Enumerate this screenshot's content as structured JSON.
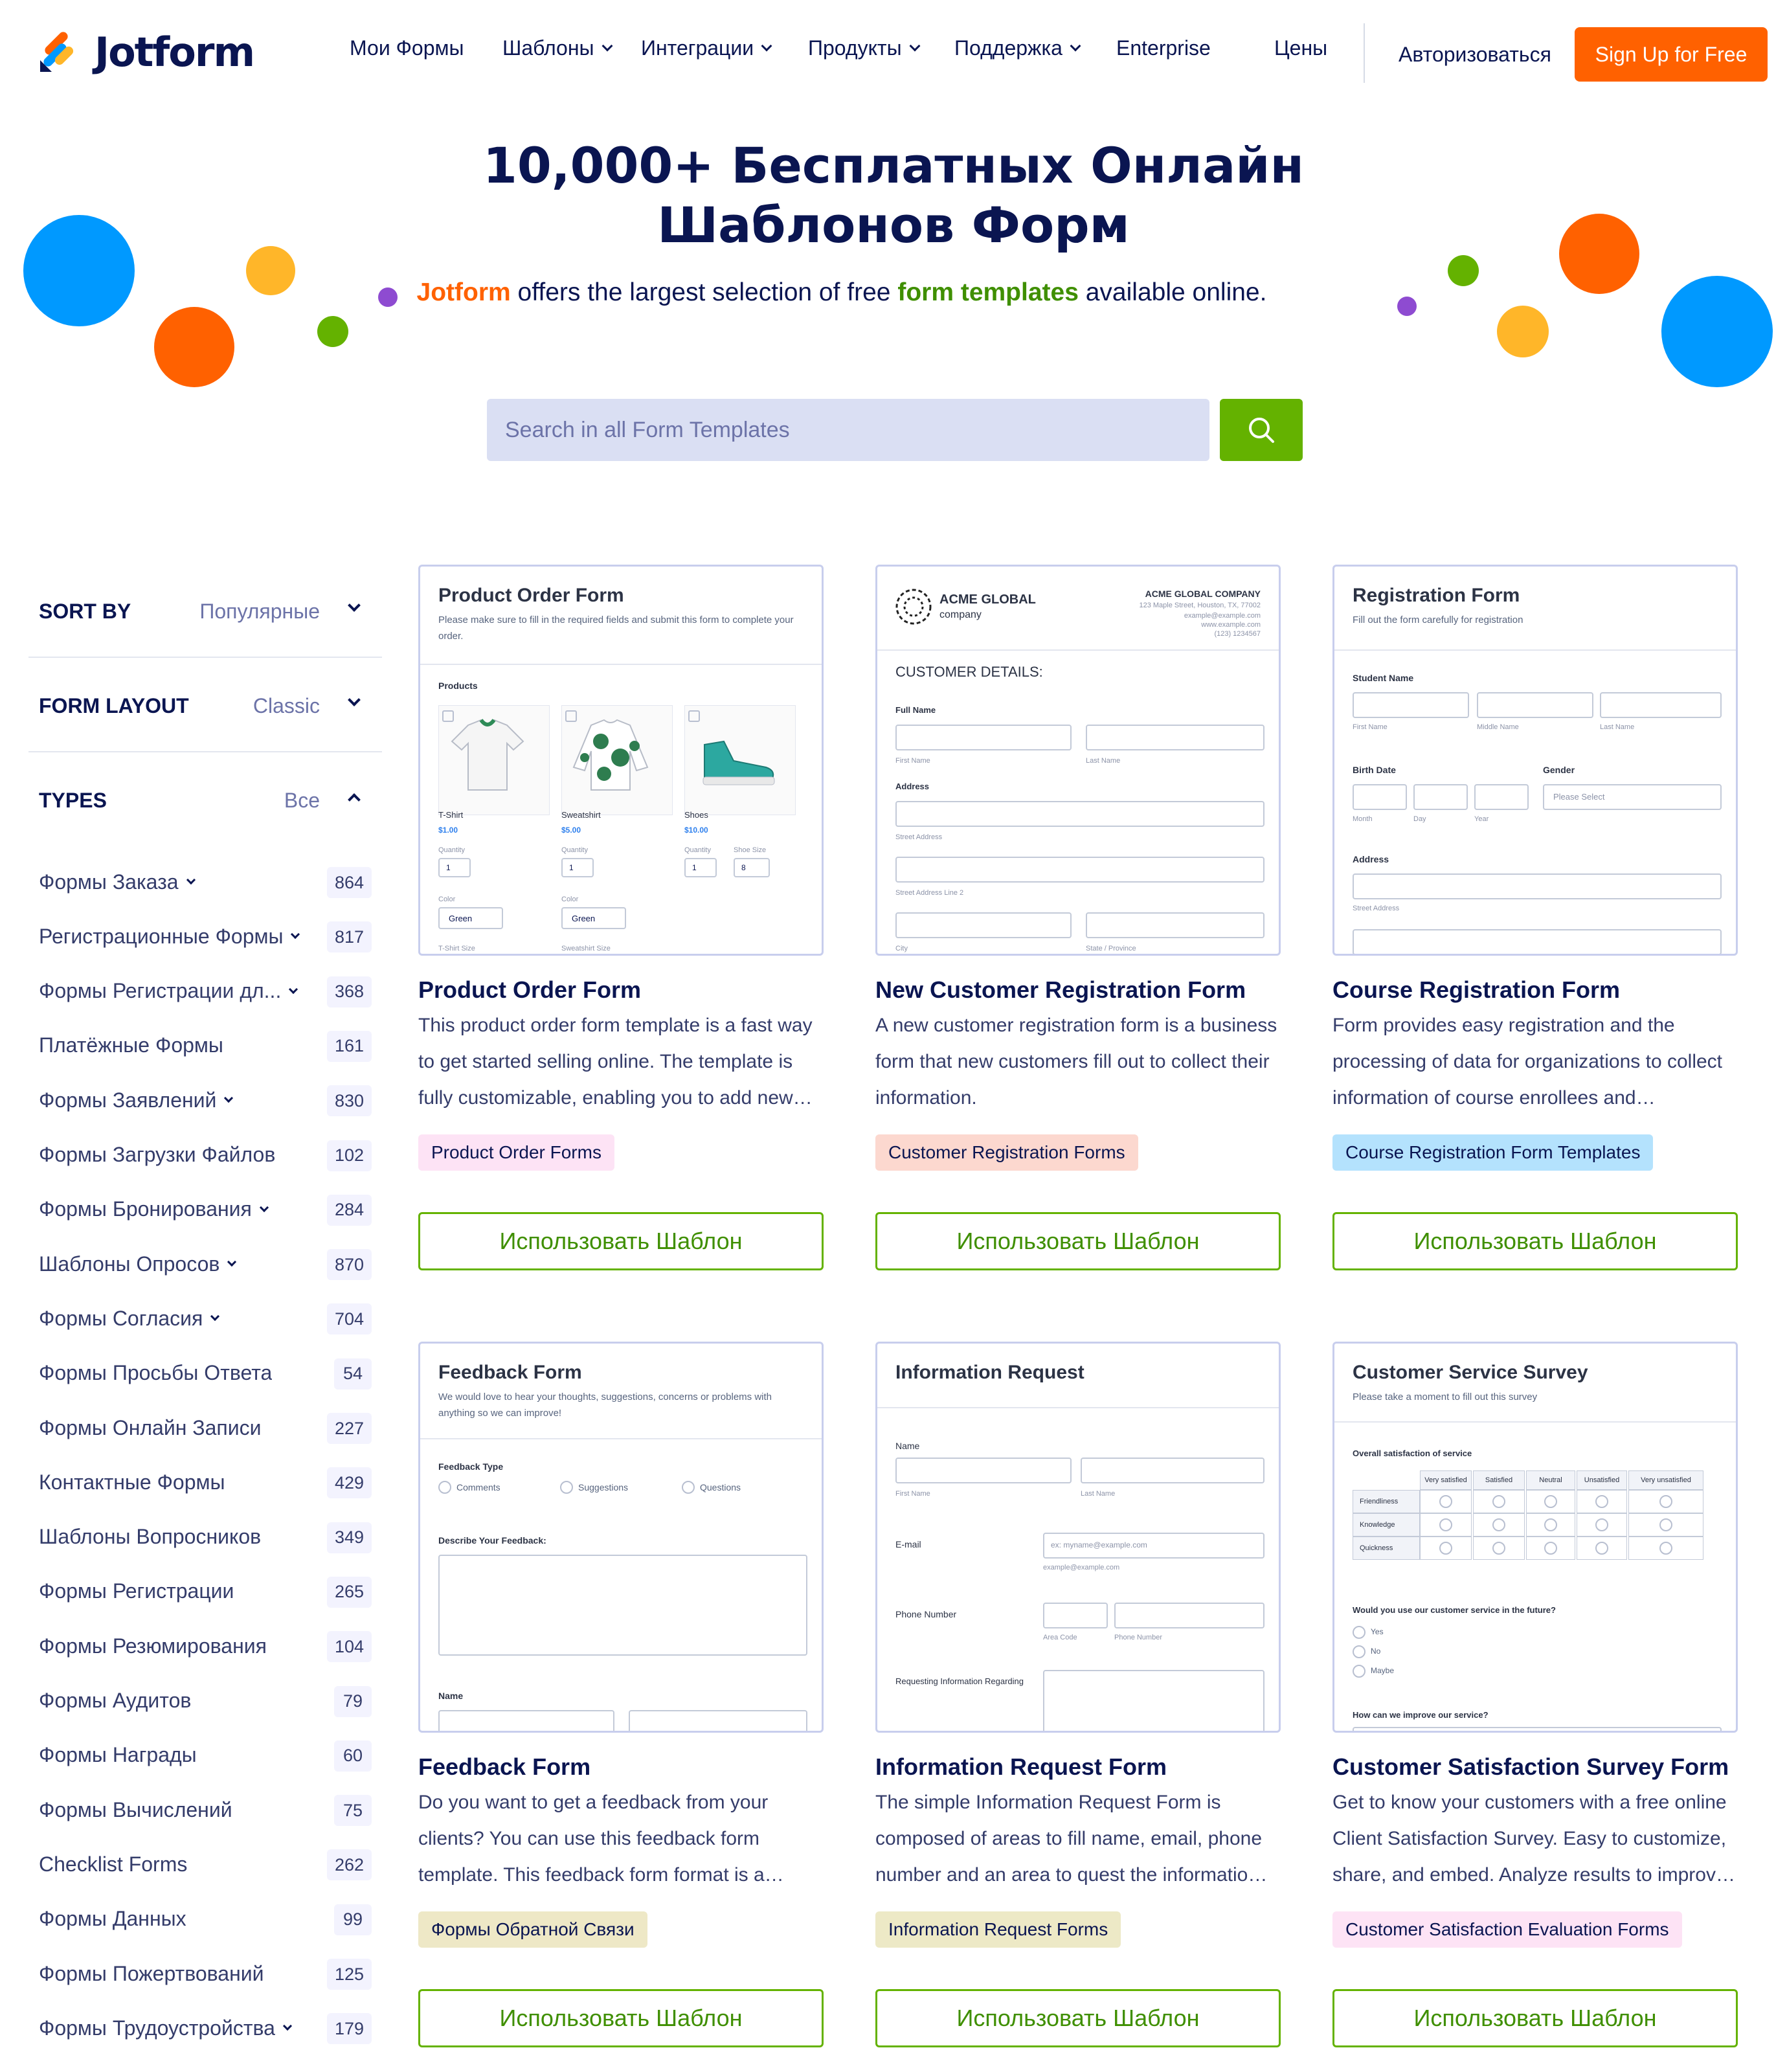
{
  "header": {
    "logo_text": "Jotform",
    "nav": [
      {
        "label": "Мои Формы",
        "dropdown": false
      },
      {
        "label": "Шаблоны",
        "dropdown": true
      },
      {
        "label": "Интеграции",
        "dropdown": true
      },
      {
        "label": "Продукты",
        "dropdown": true
      },
      {
        "label": "Поддержка",
        "dropdown": true
      },
      {
        "label": "Enterprise",
        "dropdown": false
      },
      {
        "label": "Цены",
        "dropdown": false
      }
    ],
    "login_label": "Авторизоваться",
    "signup_label": "Sign Up for Free"
  },
  "hero": {
    "title_line1": "10,000+ Бесплатных Онлайн",
    "title_line2": "Шаблонов Форм",
    "sub_brand": "Jotform",
    "sub_part1": " offers the largest selection of free ",
    "sub_link": "form templates",
    "sub_part2": " available online.",
    "search_placeholder": "Search in all Form Templates"
  },
  "colors": {
    "brand_orange": "#ff6100",
    "brand_green": "#64b200",
    "navy": "#0a1551"
  },
  "sidebar": {
    "sort": {
      "label": "SORT BY",
      "value": "Популярные"
    },
    "layout": {
      "label": "FORM LAYOUT",
      "value": "Classic"
    },
    "types": {
      "label": "TYPES",
      "value": "Все"
    },
    "items": [
      {
        "label": "Формы Заказа",
        "count": "864",
        "expandable": true
      },
      {
        "label": "Регистрационные Формы",
        "count": "817",
        "expandable": true
      },
      {
        "label": "Формы Регистрации дл...",
        "count": "368",
        "expandable": true
      },
      {
        "label": "Платёжные Формы",
        "count": "161",
        "expandable": false
      },
      {
        "label": "Формы Заявлений",
        "count": "830",
        "expandable": true
      },
      {
        "label": "Формы Загрузки Файлов",
        "count": "102",
        "expandable": false
      },
      {
        "label": "Формы Бронирования",
        "count": "284",
        "expandable": true
      },
      {
        "label": "Шаблоны Опросов",
        "count": "870",
        "expandable": true
      },
      {
        "label": "Формы Согласия",
        "count": "704",
        "expandable": true
      },
      {
        "label": "Формы Просьбы Ответа",
        "count": "54",
        "expandable": false
      },
      {
        "label": "Формы Онлайн Записи",
        "count": "227",
        "expandable": false
      },
      {
        "label": "Контактные Формы",
        "count": "429",
        "expandable": false
      },
      {
        "label": "Шаблоны Вопросников",
        "count": "349",
        "expandable": false
      },
      {
        "label": "Формы Регистрации",
        "count": "265",
        "expandable": false
      },
      {
        "label": "Формы Резюмирования",
        "count": "104",
        "expandable": false
      },
      {
        "label": "Формы Аудитов",
        "count": "79",
        "expandable": false
      },
      {
        "label": "Формы Награды",
        "count": "60",
        "expandable": false
      },
      {
        "label": "Формы Вычислений",
        "count": "75",
        "expandable": false
      },
      {
        "label": "Checklist Forms",
        "count": "262",
        "expandable": false
      },
      {
        "label": "Формы Данных",
        "count": "99",
        "expandable": false
      },
      {
        "label": "Формы Пожертвований",
        "count": "125",
        "expandable": false
      },
      {
        "label": "Формы Трудоустройства",
        "count": "179",
        "expandable": true
      }
    ]
  },
  "use_template_label": "Использовать Шаблон",
  "cards": [
    {
      "title": "Product Order Form",
      "desc": "This product order form template is a fast way to get started selling online. The template is fully customizable, enabling you to add new…",
      "tag": "Product Order Forms",
      "tag_color": "#fde3f5",
      "thumb": {
        "head": "Product Order Form",
        "sub": "Please make sure to fill in the required fields and submit this form to complete your order.",
        "products_label": "Products",
        "products": [
          {
            "name": "T-Shirt",
            "price": "$1.00",
            "qty_label": "Quantity",
            "qty": "1",
            "color_label": "Color",
            "color": "Green",
            "size_label": "T-Shirt Size"
          },
          {
            "name": "Sweatshirt",
            "price": "$5.00",
            "qty_label": "Quantity",
            "qty": "1",
            "color_label": "Color",
            "color": "Green",
            "size_label": "Sweatshirt Size"
          },
          {
            "name": "Shoes",
            "price": "$10.00",
            "qty_label": "Quantity",
            "qty": "1",
            "size_label": "Shoe Size",
            "size": "8"
          }
        ]
      }
    },
    {
      "title": "New Customer Registration Form",
      "desc": "A new customer registration form is a business form that new customers fill out to collect their information.",
      "tag": "Customer Registration Forms",
      "tag_color": "#fcd8cf",
      "thumb": {
        "company_logo_l1": "ACME GLOBAL",
        "company_logo_l2": "company",
        "company_name": "ACME GLOBAL COMPANY",
        "company_addr": "123 Maple Street, Houston, TX, 77002",
        "company_email": "example@example.com",
        "company_web": "www.example.com",
        "company_phone": "(123) 1234567",
        "section": "CUSTOMER DETAILS:",
        "full_name": "Full Name",
        "first_name": "First Name",
        "last_name": "Last Name",
        "address": "Address",
        "street": "Street Address",
        "street2": "Street Address Line 2",
        "city": "City",
        "state": "State / Province"
      }
    },
    {
      "title": "Course Registration Form",
      "desc": "Form provides easy registration and the processing of data for organizations to collect information of course enrollees and…",
      "tag": "Course Registration Form Templates",
      "tag_color": "#b4e2fd",
      "thumb": {
        "head": "Registration Form",
        "sub": "Fill out the form carefully for registration",
        "student_name": "Student Name",
        "first": "First Name",
        "middle": "Middle Name",
        "last": "Last Name",
        "birth": "Birth Date",
        "month": "Month",
        "day": "Day",
        "year": "Year",
        "gender": "Gender",
        "gender_ph": "Please Select",
        "address": "Address",
        "street": "Street Address"
      }
    },
    {
      "title": "Feedback Form",
      "desc": "Do you want to get a feedback from your clients? You can use this feedback form template. This feedback form format is a…",
      "tag": "Формы Обратной Связи",
      "tag_color": "#eee8c6",
      "thumb": {
        "head": "Feedback Form",
        "sub": "We would love to hear your thoughts, suggestions, concerns or problems with anything so we can improve!",
        "type_label": "Feedback Type",
        "opt1": "Comments",
        "opt2": "Suggestions",
        "opt3": "Questions",
        "describe": "Describe Your Feedback:",
        "name": "Name"
      }
    },
    {
      "title": "Information Request Form",
      "desc": "The simple Information Request Form is composed of areas to fill name, email, phone number and an area to quest the informatio…",
      "tag": "Information Request Forms",
      "tag_color": "#ede9c6",
      "thumb": {
        "head": "Information Request",
        "name": "Name",
        "first": "First Name",
        "last": "Last Name",
        "email": "E-mail",
        "email_ph": "ex: myname@example.com",
        "email_hint": "example@example.com",
        "phone": "Phone Number",
        "area": "Area Code",
        "phone_sub": "Phone Number",
        "req": "Requesting Information Regarding"
      }
    },
    {
      "title": "Customer Satisfaction Survey Form",
      "desc": "Get to know your customers with a free online Client Satisfaction Survey. Easy to customize, share, and embed. Analyze results to improv…",
      "tag": "Customer Satisfaction Evaluation Forms",
      "tag_color": "#fde3f5",
      "thumb": {
        "head": "Customer Service Survey",
        "sub": "Please take a moment to fill out this survey",
        "overall": "Overall satisfaction of service",
        "cols": [
          "Very satisfied",
          "Satisfied",
          "Neutral",
          "Unsatisfied",
          "Very unsatisfied"
        ],
        "rows": [
          "Friendliness",
          "Knowledge",
          "Quickness"
        ],
        "future": "Would you use our customer service in the future?",
        "yes": "Yes",
        "no": "No",
        "maybe": "Maybe",
        "improve": "How can we improve our service?"
      }
    }
  ]
}
